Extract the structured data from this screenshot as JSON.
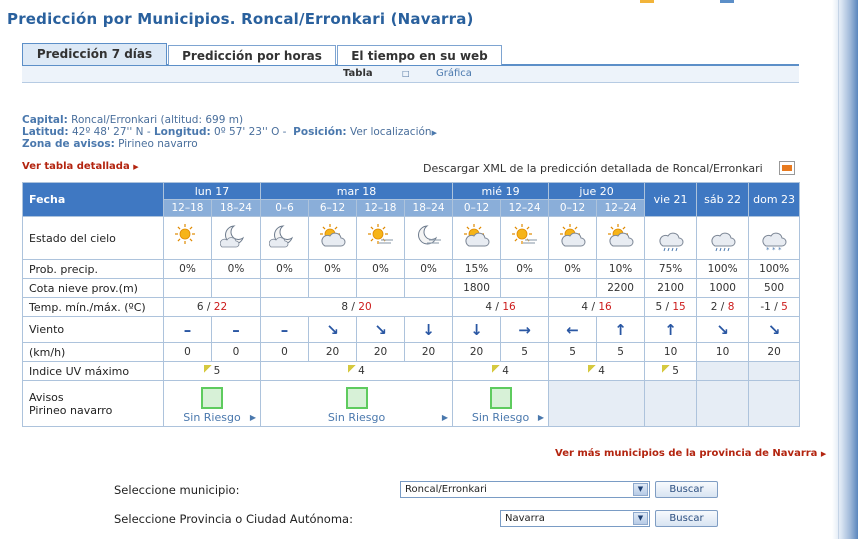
{
  "page": {
    "title": "Predicción por Municipios. Roncal/Erronkari (Navarra)"
  },
  "tabs": [
    {
      "label": "Predicción 7 días",
      "active": true
    },
    {
      "label": "Predicción por horas",
      "active": false
    },
    {
      "label": "El tiempo en su web",
      "active": false
    }
  ],
  "subnav": {
    "tabla": "Tabla",
    "separator": "□",
    "grafica": "Gráfica"
  },
  "info": {
    "capital_label": "Capital:",
    "capital_value": "Roncal/Erronkari (altitud: 699 m)",
    "latitud_label": "Latitud:",
    "latitud_value": "42º 48' 27'' N -",
    "longitud_label": "Longitud:",
    "longitud_value": "0º 57' 23'' O -",
    "posicion_label": "Posición:",
    "posicion_value": "Ver localización",
    "zona_label": "Zona de avisos:",
    "zona_value": "Pirineo navarro"
  },
  "links": {
    "tabla_detallada": "Ver tabla detallada",
    "xml": "Descargar XML de la predicción detallada de Roncal/Erronkari",
    "mas_municipios": "Ver más municipios de la provincia de Navarra"
  },
  "forecast": {
    "fecha_label": "Fecha",
    "days": [
      {
        "label": "lun 17"
      },
      {
        "label": "mar 18"
      },
      {
        "label": "mié 19"
      },
      {
        "label": "jue 20"
      },
      {
        "label": "vie 21"
      },
      {
        "label": "sáb 22"
      },
      {
        "label": "dom 23"
      }
    ],
    "periods": [
      "12–18",
      "18–24",
      "0–6",
      "6–12",
      "12–18",
      "18–24",
      "0–12",
      "12–24",
      "0–12",
      "12–24"
    ],
    "row_labels": {
      "sky": "Estado del cielo",
      "precip": "Prob. precip.",
      "snow": "Cota nieve prov.(m)",
      "temp": "Temp. mín./máx. (ºC)",
      "wind": "Viento",
      "wind_unit": "(km/h)",
      "uv": "Indice UV máximo",
      "avisos": "Avisos",
      "avisos_zone": "Pirineo navarro"
    },
    "sky_icons": [
      "sun-icon",
      "moon-cloud-icon",
      "moon-cloud-icon",
      "sun-cloud-icon",
      "sun-haze-icon",
      "moon-haze-icon",
      "sun-cloud-icon",
      "sun-haze-icon",
      "sun-cloud-icon",
      "sun-cloud-icon",
      "rain-icon",
      "rain-icon",
      "snow-icon"
    ],
    "precip": [
      "0%",
      "0%",
      "0%",
      "0%",
      "0%",
      "0%",
      "15%",
      "0%",
      "0%",
      "10%",
      "75%",
      "100%",
      "100%"
    ],
    "snow": [
      "",
      "",
      "",
      "",
      "",
      "",
      "1800",
      "",
      "",
      "2200",
      "2100",
      "1000",
      "500"
    ],
    "temp": [
      {
        "min": "6",
        "max": "22"
      },
      {
        "min": "8",
        "max": "20"
      },
      {
        "min": "4",
        "max": "16"
      },
      {
        "min": "4",
        "max": "16"
      },
      {
        "min": "5",
        "max": "15"
      },
      {
        "min": "2",
        "max": "8"
      },
      {
        "min": "-1",
        "max": "5"
      }
    ],
    "wind_dir": [
      "–",
      "–",
      "–",
      "↘",
      "↘",
      "↓",
      "↓",
      "→",
      "←",
      "↑",
      "↑",
      "↘",
      "↘"
    ],
    "wind_speed": [
      "0",
      "0",
      "0",
      "20",
      "20",
      "20",
      "20",
      "5",
      "5",
      "5",
      "10",
      "10",
      "20"
    ],
    "uv": [
      "5",
      "4",
      "4",
      "4",
      "5",
      "",
      ""
    ],
    "risk_label": "Sin Riesgo"
  },
  "form": {
    "municipio_label": "Seleccione municipio:",
    "municipio_value": "Roncal/Erronkari",
    "provincia_label": "Seleccione Provincia o Ciudad Autónoma:",
    "provincia_value": "Navarra",
    "buscar": "Buscar"
  },
  "colors": {
    "header_blue": "#3f78c2",
    "subheader_blue": "#8aaed9",
    "title_blue": "#29609d",
    "link_red": "#b3240f",
    "temp_max_red": "#cc1b1b",
    "risk_green": "#5ecb5e"
  }
}
